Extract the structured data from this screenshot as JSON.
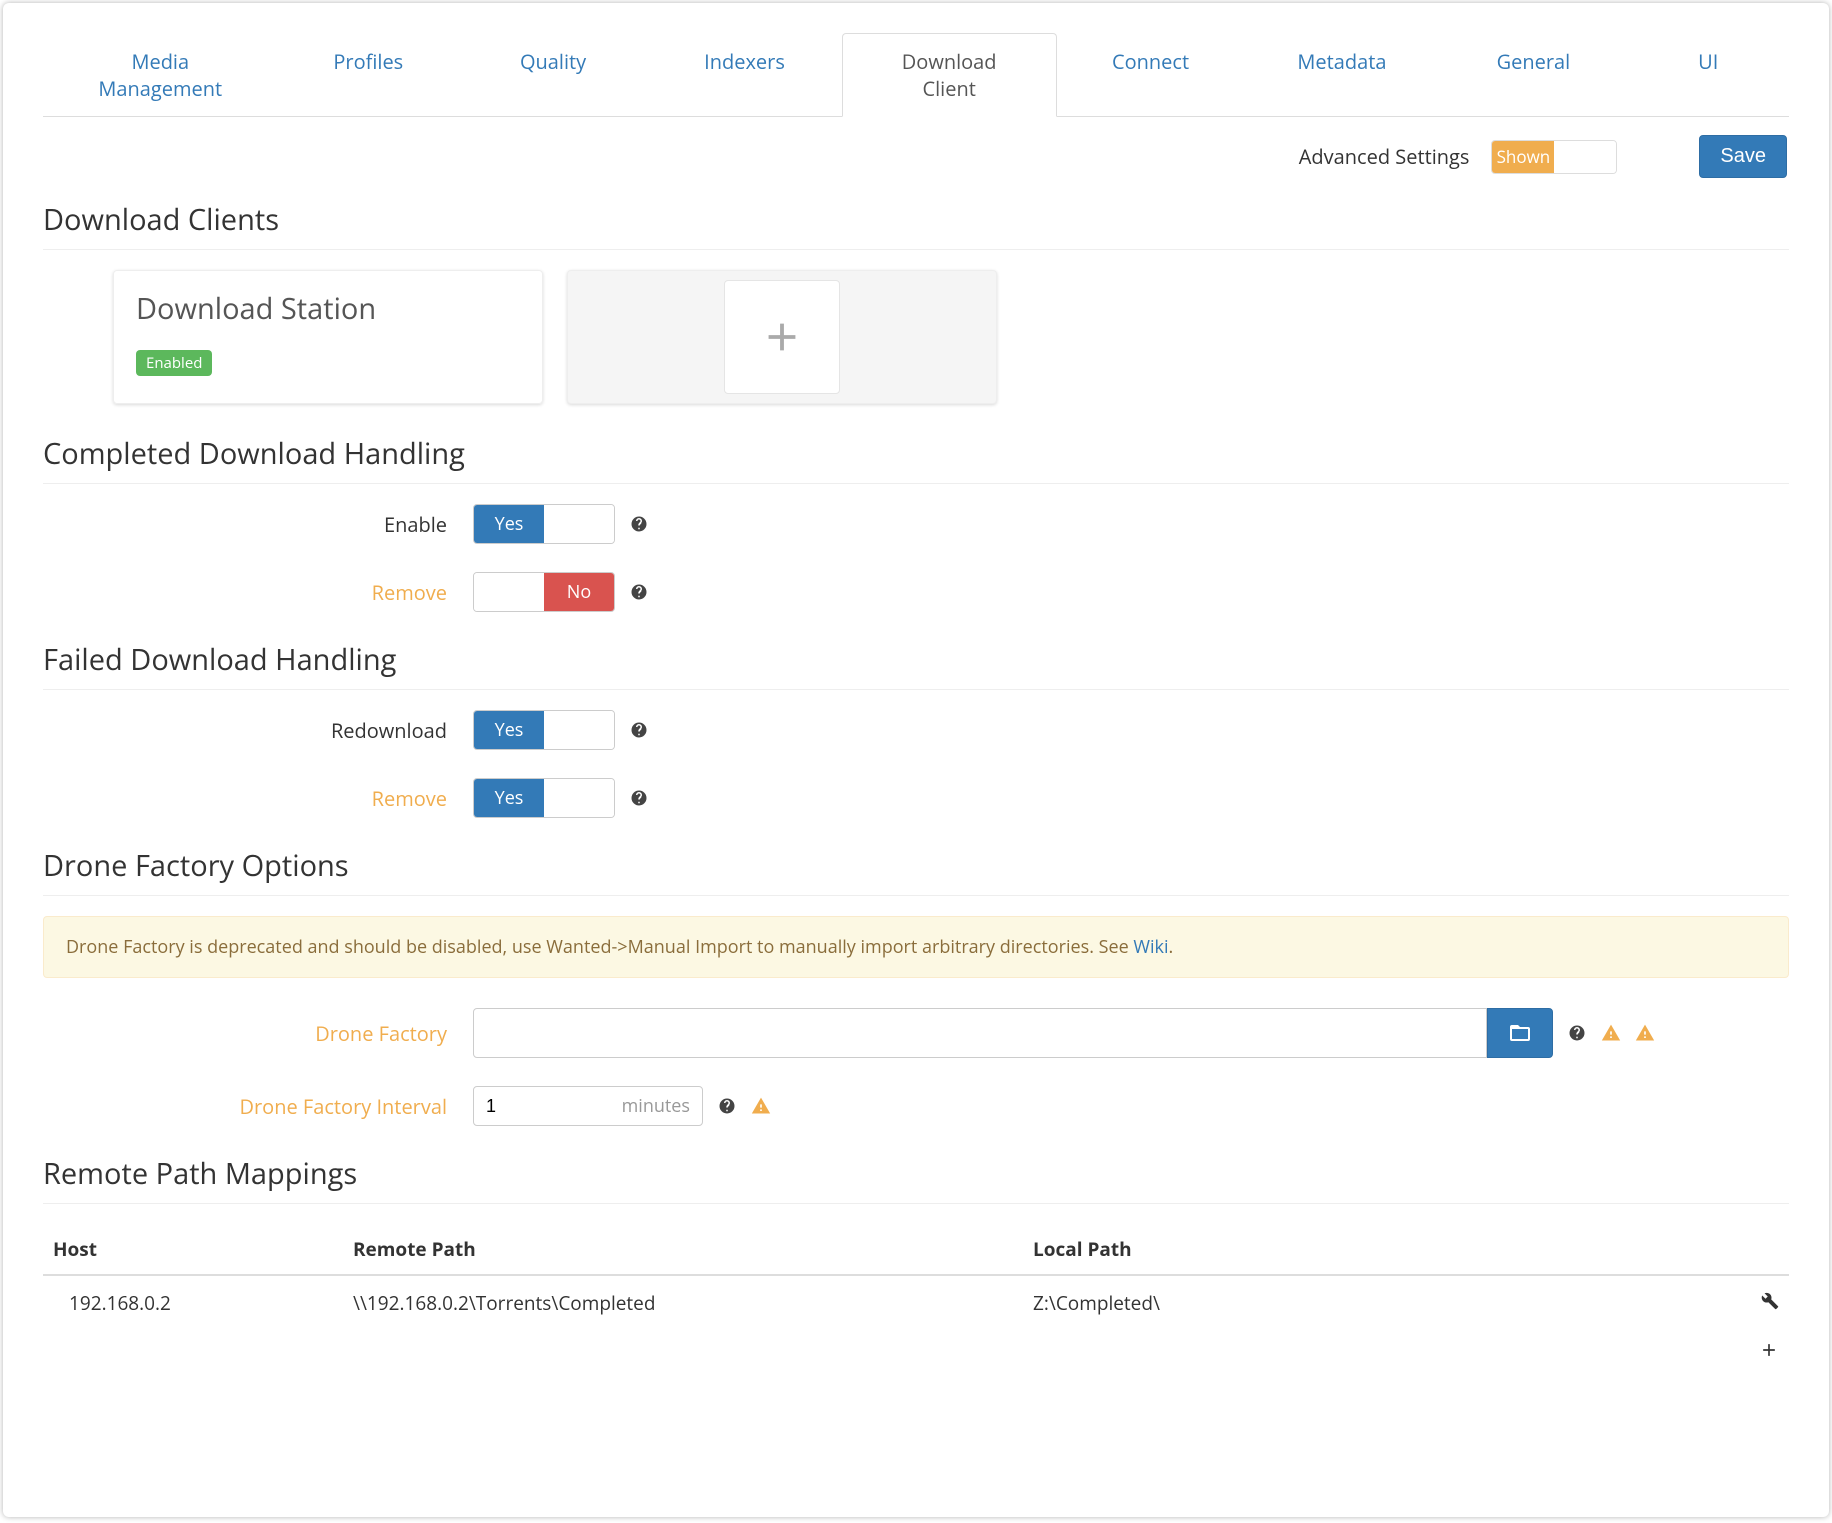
{
  "tabs": {
    "items": [
      {
        "label": "Media Management"
      },
      {
        "label": "Profiles"
      },
      {
        "label": "Quality"
      },
      {
        "label": "Indexers"
      },
      {
        "label": "Download Client"
      },
      {
        "label": "Connect"
      },
      {
        "label": "Metadata"
      },
      {
        "label": "General"
      },
      {
        "label": "UI"
      }
    ],
    "active": "Download Client"
  },
  "topbar": {
    "advanced_label": "Advanced Settings",
    "shown_label": "Shown",
    "save_label": "Save"
  },
  "sections": {
    "download_clients": {
      "title": "Download Clients",
      "card_title": "Download Station",
      "enabled_badge": "Enabled"
    },
    "completed": {
      "title": "Completed Download Handling",
      "enable_label": "Enable",
      "remove_label": "Remove",
      "enable_value": "Yes",
      "remove_value": "No"
    },
    "failed": {
      "title": "Failed Download Handling",
      "redownload_label": "Redownload",
      "remove_label": "Remove",
      "redownload_value": "Yes",
      "remove_value": "Yes"
    },
    "drone": {
      "title": "Drone Factory Options",
      "alert_text": "Drone Factory is deprecated and should be disabled, use Wanted->Manual Import to manually import arbitrary directories. See ",
      "alert_link": "Wiki",
      "alert_suffix": ".",
      "factory_label": "Drone Factory",
      "interval_label": "Drone Factory Interval",
      "interval_value": "1",
      "interval_unit": "minutes"
    },
    "remote": {
      "title": "Remote Path Mappings",
      "headers": {
        "host": "Host",
        "remote": "Remote Path",
        "local": "Local Path"
      },
      "row": {
        "host": "192.168.0.2",
        "remote": "\\\\192.168.0.2\\Torrents\\Completed",
        "local": "Z:\\Completed\\"
      }
    }
  },
  "str": {
    "yes": "Yes",
    "no": "No"
  }
}
